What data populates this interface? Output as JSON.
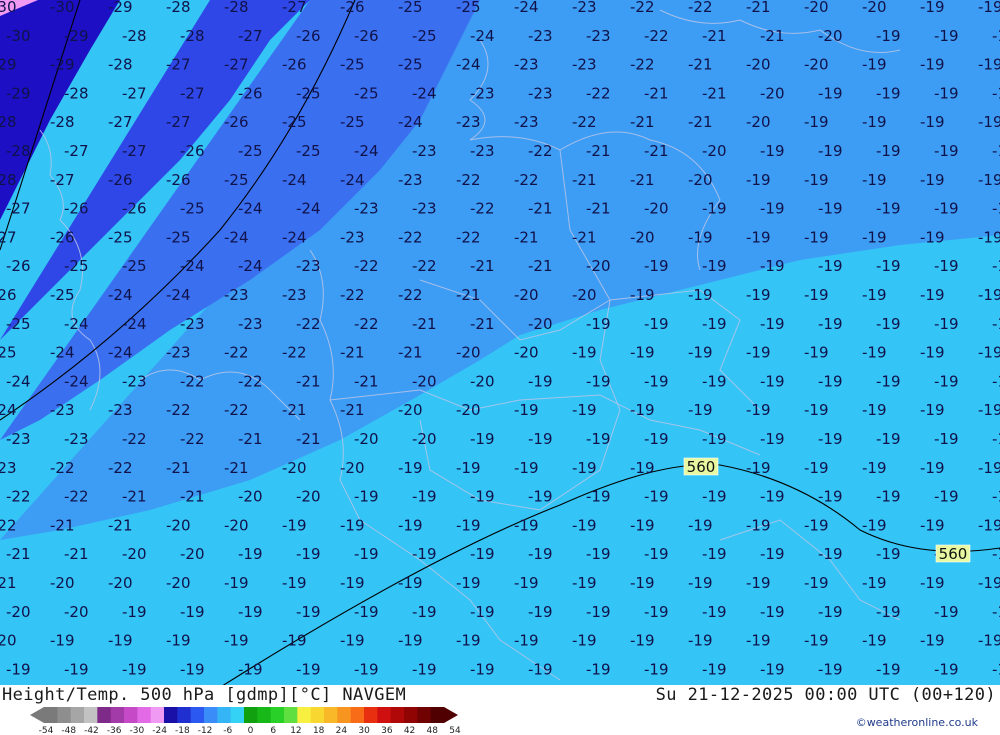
{
  "footer": {
    "title": "Height/Temp. 500 hPa [gdmp][°C] NAVGEM",
    "valid": "Su 21-12-2025 00:00 UTC (00+120)",
    "credit": "©weatheronline.co.uk"
  },
  "legend": {
    "ticks": [
      "-54",
      "-48",
      "-42",
      "-36",
      "-30",
      "-24",
      "-18",
      "-12",
      "-6",
      "0",
      "6",
      "12",
      "18",
      "24",
      "30",
      "36",
      "42",
      "48",
      "54"
    ],
    "colors": [
      "#7a7a7a",
      "#8e8e8e",
      "#a6a6a6",
      "#c2c2c2",
      "#7e2a88",
      "#a23aa8",
      "#c64ac8",
      "#e26ae6",
      "#f09af4",
      "#1a10a8",
      "#2030d0",
      "#2a58f0",
      "#3a8cf8",
      "#35b4f6",
      "#34d2f4",
      "#10a010",
      "#18b818",
      "#28d028",
      "#60e040",
      "#f8f040",
      "#f8d830",
      "#f8b828",
      "#f89420",
      "#f86c18",
      "#e83010",
      "#d01010",
      "#b00808",
      "#900404",
      "#700202",
      "#500000"
    ]
  },
  "map": {
    "contour_labels": [
      {
        "text": "560"
      },
      {
        "text": "560"
      }
    ],
    "isotherm_colors": {
      "le_-30": "#1c0fc4",
      "-29_-27": "#2f47e6",
      "-26_-24": "#3a6ff0",
      "-23_-21": "#3d9cf4",
      "ge_-20": "#34c4f6"
    }
  }
}
